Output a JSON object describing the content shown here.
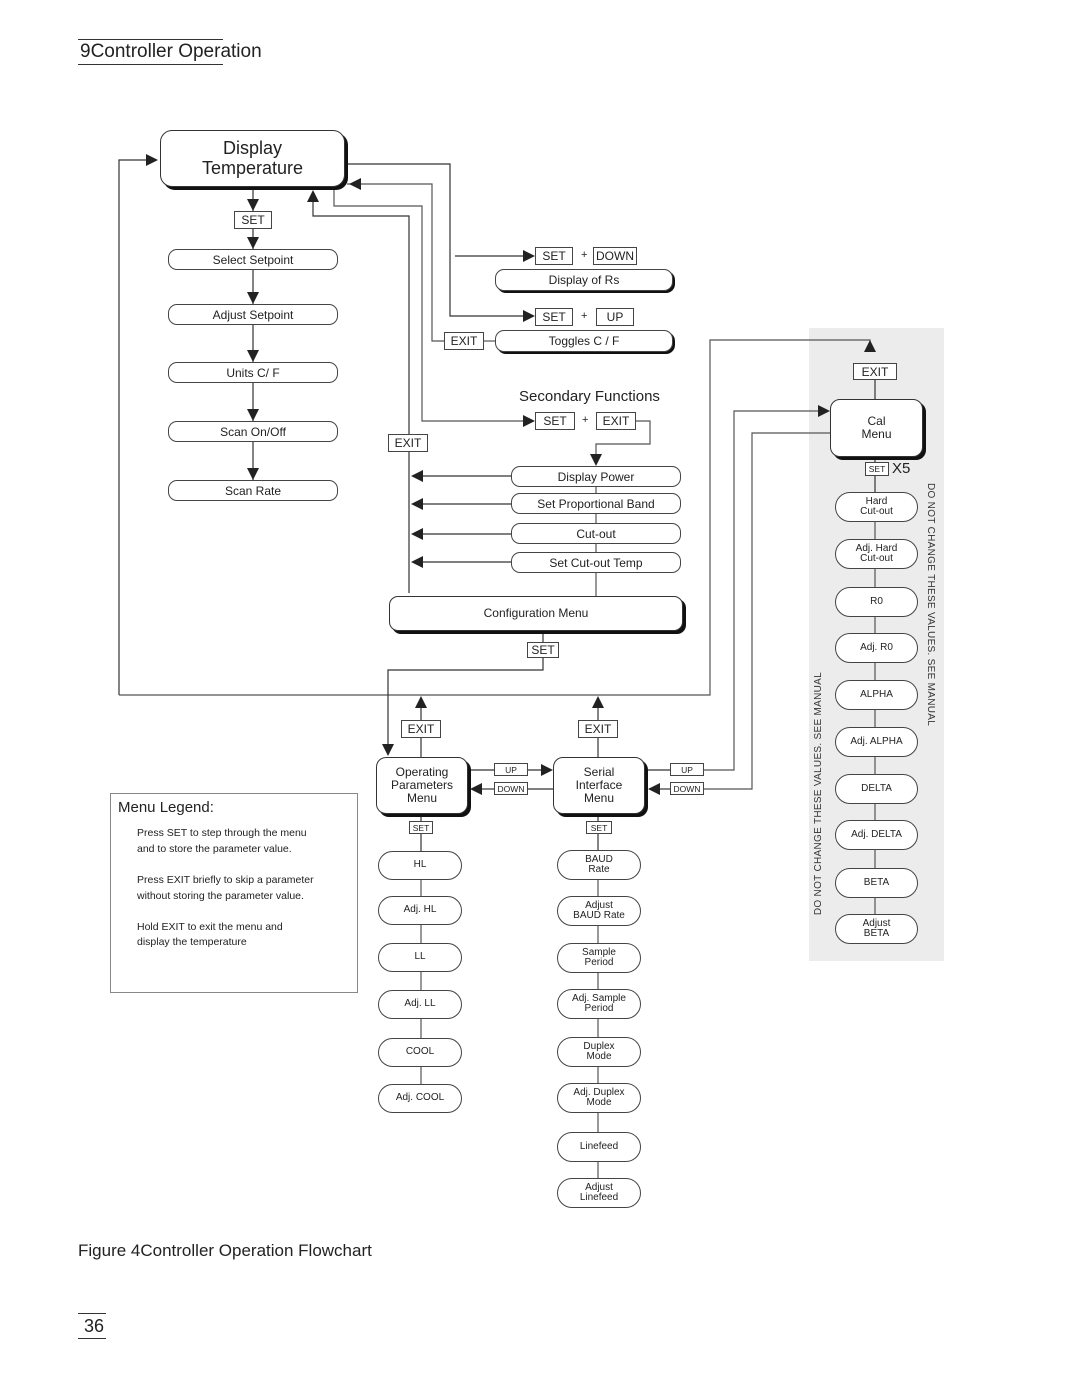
{
  "header": {
    "section_title": "9Controller Operation"
  },
  "main_node": {
    "line1": "Display",
    "line2": "Temperature"
  },
  "keys": {
    "set": "SET",
    "exit": "EXIT",
    "up": "UP",
    "down": "DOWN",
    "plus": "+",
    "x5": "X5"
  },
  "primary_menu": [
    "Select Setpoint",
    "Adjust Setpoint",
    "Units  C/ F",
    "Scan On/Off",
    "Scan Rate"
  ],
  "shortcuts": {
    "display_rs": "Display of Rs",
    "toggles_cf": "Toggles  C /  F"
  },
  "secondary": {
    "title": "Secondary Functions",
    "items": [
      "Display Power",
      "Set Proportional Band",
      "Cut-out",
      "Set Cut-out Temp"
    ]
  },
  "config_menu": "Configuration Menu",
  "operating_menu": {
    "label": "Operating\nParameters\nMenu",
    "items": [
      "HL",
      "Adj. HL",
      "LL",
      "Adj. LL",
      "COOL",
      "Adj. COOL"
    ]
  },
  "serial_menu": {
    "label": "Serial\nInterface\nMenu",
    "items": [
      "BAUD\nRate",
      "Adjust\nBAUD Rate",
      "Sample\nPeriod",
      "Adj. Sample\nPeriod",
      "Duplex\nMode",
      "Adj. Duplex\nMode",
      "Linefeed",
      "Adjust\nLinefeed"
    ]
  },
  "cal_menu": {
    "label": "Cal\nMenu",
    "items": [
      "Hard\nCut-out",
      "Adj. Hard\nCut-out",
      "R0",
      "Adj. R0",
      "ALPHA",
      "Adj. ALPHA",
      "DELTA",
      "Adj. DELTA",
      "BETA",
      "Adjust\nBETA"
    ]
  },
  "warnings": {
    "right": "DO NOT CHANGE THESE VALUES.  SEE MANUAL",
    "left": "DO NOT CHANGE THESE VALUES.  SEE MANUAL"
  },
  "legend": {
    "title": "Menu Legend:",
    "lines": [
      "Press  SET  to step through the menu",
      "and to store the parameter value.",
      "Press  EXIT  briefly to skip a parameter",
      "without storing the parameter value.",
      "Hold  EXIT  to exit the menu and",
      "display the temperature"
    ]
  },
  "figure_caption": "Figure 4Controller Operation Flowchart",
  "page_number": "36"
}
